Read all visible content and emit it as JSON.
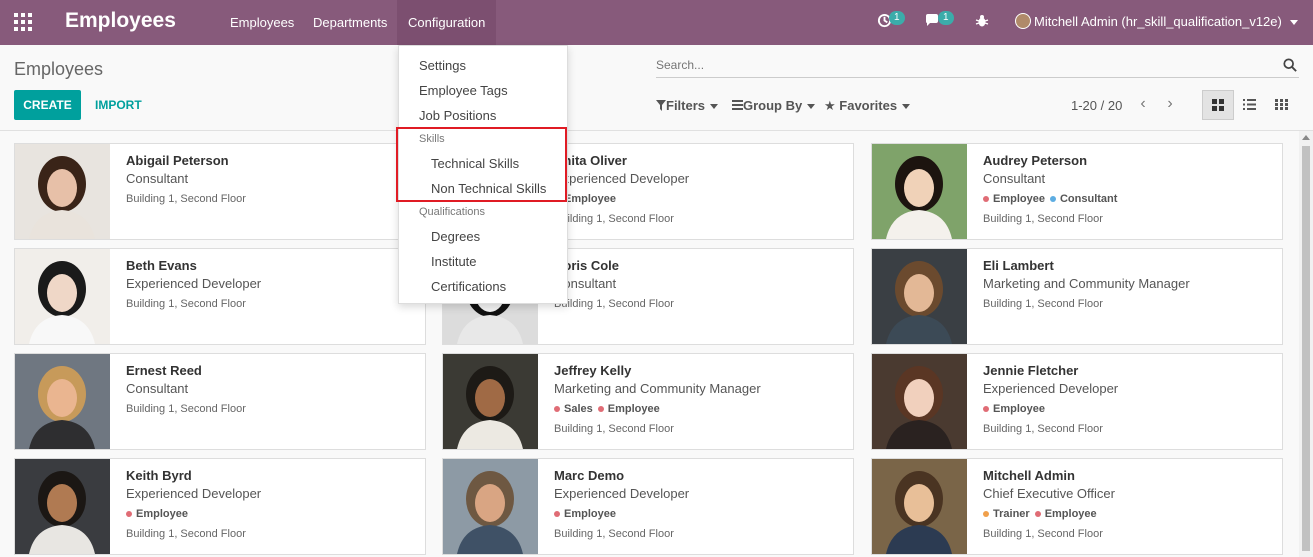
{
  "topbar": {
    "brand": "Employees",
    "menu": [
      "Employees",
      "Departments",
      "Configuration"
    ],
    "activity_count": "1",
    "messages_count": "1",
    "user": "Mitchell Admin (hr_skill_qualification_v12e)"
  },
  "control_panel": {
    "breadcrumb": "Employees",
    "create_label": "CREATE",
    "import_label": "IMPORT",
    "search_placeholder": "Search...",
    "filters_label": "Filters",
    "groupby_label": "Group By",
    "favorites_label": "Favorites",
    "pager": "1-20 / 20"
  },
  "config_menu": {
    "settings": "Settings",
    "employee_tags": "Employee Tags",
    "job_positions": "Job Positions",
    "skills_header": "Skills",
    "technical_skills": "Technical Skills",
    "non_technical_skills": "Non Technical Skills",
    "qualifications_header": "Qualifications",
    "degrees": "Degrees",
    "institute": "Institute",
    "certifications": "Certifications"
  },
  "tag_colors": {
    "Employee": "#e06c75",
    "Consultant": "#5dade2",
    "Sales": "#e06c75",
    "Trainer": "#f0a04b"
  },
  "employees": [
    {
      "name": "Abigail Peterson",
      "job": "Consultant",
      "tags": [],
      "location": "Building 1, Second Floor"
    },
    {
      "name": "Anita Oliver",
      "job": "Experienced Developer",
      "tags": [
        "Employee"
      ],
      "location": "Building 1, Second Floor"
    },
    {
      "name": "Audrey Peterson",
      "job": "Consultant",
      "tags": [
        "Employee",
        "Consultant"
      ],
      "location": "Building 1, Second Floor"
    },
    {
      "name": "Beth Evans",
      "job": "Experienced Developer",
      "tags": [],
      "location": "Building 1, Second Floor"
    },
    {
      "name": "Doris Cole",
      "job": "Consultant",
      "tags": [],
      "location": "Building 1, Second Floor"
    },
    {
      "name": "Eli Lambert",
      "job": "Marketing and Community Manager",
      "tags": [],
      "location": "Building 1, Second Floor"
    },
    {
      "name": "Ernest Reed",
      "job": "Consultant",
      "tags": [],
      "location": "Building 1, Second Floor"
    },
    {
      "name": "Jeffrey Kelly",
      "job": "Marketing and Community Manager",
      "tags": [
        "Sales",
        "Employee"
      ],
      "location": "Building 1, Second Floor"
    },
    {
      "name": "Jennie Fletcher",
      "job": "Experienced Developer",
      "tags": [
        "Employee"
      ],
      "location": "Building 1, Second Floor"
    },
    {
      "name": "Keith Byrd",
      "job": "Experienced Developer",
      "tags": [
        "Employee"
      ],
      "location": "Building 1, Second Floor"
    },
    {
      "name": "Marc Demo",
      "job": "Experienced Developer",
      "tags": [
        "Employee"
      ],
      "location": "Building 1, Second Floor"
    },
    {
      "name": "Mitchell Admin",
      "job": "Chief Executive Officer",
      "tags": [
        "Trainer",
        "Employee"
      ],
      "location": "Building 1, Second Floor"
    }
  ]
}
